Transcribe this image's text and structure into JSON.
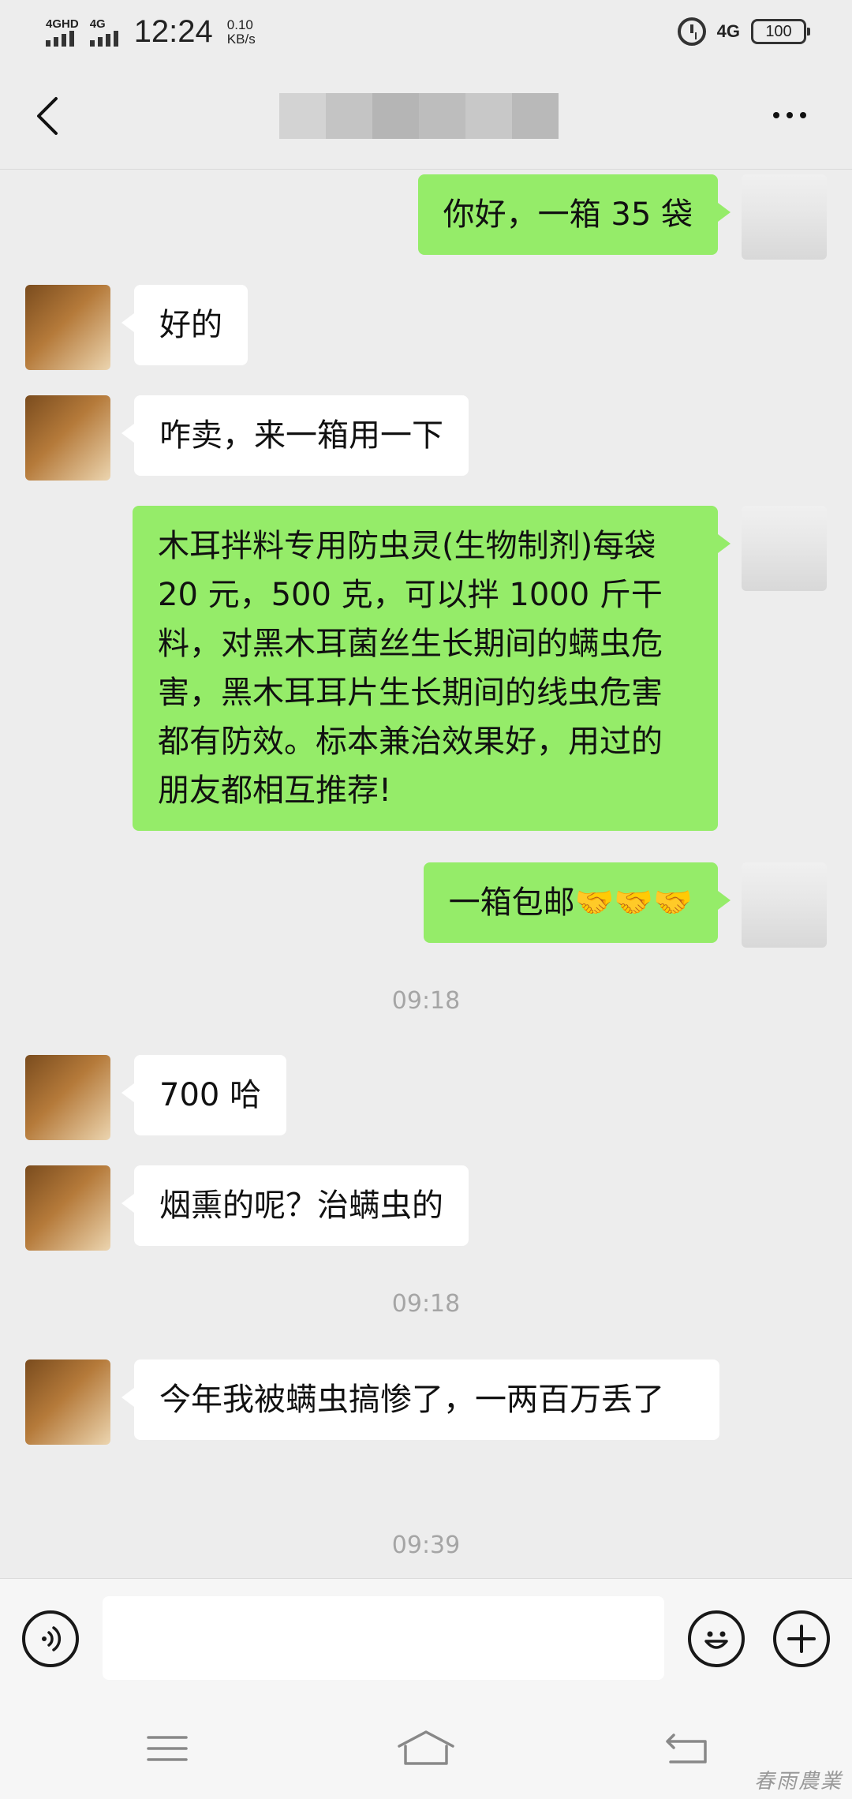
{
  "status_bar": {
    "signal1_label": "4GHD",
    "signal2_label": "4G",
    "time": "12:24",
    "speed_value": "0.10",
    "speed_unit": "KB/s",
    "network_label": "4G",
    "battery": "100",
    "icons": [
      "signal-icon",
      "alarm-icon",
      "battery-icon"
    ]
  },
  "nav": {
    "back_icon": "chevron-left-icon",
    "more_icon": "more-dots-icon"
  },
  "messages": [
    {
      "side": "me",
      "text": "你好，一箱 35 袋"
    },
    {
      "side": "other",
      "text": "好的"
    },
    {
      "side": "other",
      "text": "咋卖，来一箱用一下"
    },
    {
      "side": "me",
      "text": "木耳拌料专用防虫灵(生物制剂)每袋 20 元，500 克，可以拌 1000 斤干料，对黑木耳菌丝生长期间的螨虫危害，黑木耳耳片生长期间的线虫危害都有防效。标本兼治效果好，用过的朋友都相互推荐!"
    },
    {
      "side": "me",
      "text": "一箱包邮🤝🤝🤝"
    },
    {
      "side": "time",
      "text": "09:18"
    },
    {
      "side": "other",
      "text": "700 哈"
    },
    {
      "side": "other",
      "text": "烟熏的呢？治螨虫的"
    },
    {
      "side": "time",
      "text": "09:18"
    },
    {
      "side": "other",
      "text": "今年我被螨虫搞惨了，一两百万丢了"
    },
    {
      "side": "time",
      "text": "09:39"
    }
  ],
  "input_bar": {
    "voice_icon": "voice-icon",
    "emoji_icon": "emoji-icon",
    "add_icon": "plus-icon",
    "input_value": ""
  },
  "system_nav": {
    "icons": [
      "menu-icon",
      "home-icon",
      "back-icon"
    ]
  },
  "watermark": "春雨農業",
  "colors": {
    "background": "#ededed",
    "my_bubble": "#95ec69",
    "other_bubble": "#ffffff",
    "time_text": "#a5a5a5"
  }
}
